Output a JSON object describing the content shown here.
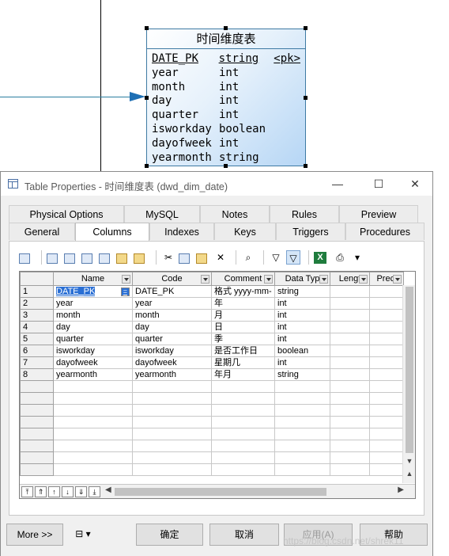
{
  "diagram": {
    "entity_name": "时间维度表",
    "attributes": [
      {
        "name": "DATE_PK",
        "type": "string",
        "key": "<pk>"
      },
      {
        "name": "year",
        "type": "int",
        "key": ""
      },
      {
        "name": "month",
        "type": "int",
        "key": ""
      },
      {
        "name": "day",
        "type": "int",
        "key": ""
      },
      {
        "name": "quarter",
        "type": "int",
        "key": ""
      },
      {
        "name": "isworkday",
        "type": "boolean",
        "key": ""
      },
      {
        "name": "dayofweek",
        "type": "int",
        "key": ""
      },
      {
        "name": "yearmonth",
        "type": "string",
        "key": ""
      }
    ]
  },
  "dialog": {
    "title": "Table Properties - 时间维度表 (dwd_dim_date)",
    "window_buttons": {
      "minimize": "—",
      "maximize": "☐",
      "close": "✕"
    },
    "tabs_row1": [
      "Physical Options",
      "MySQL",
      "Notes",
      "Rules",
      "Preview"
    ],
    "tabs_row2": [
      "General",
      "Columns",
      "Indexes",
      "Keys",
      "Triggers",
      "Procedures"
    ],
    "active_tab": "Columns",
    "columns_table": {
      "headers": [
        "Name",
        "Code",
        "Comment",
        "Data Typ",
        "Lengt",
        "Preci"
      ],
      "rows": [
        {
          "num": "1",
          "name": "DATE_PK",
          "code": "DATE_PK",
          "comment": "格式 yyyy-mm-",
          "type": "string"
        },
        {
          "num": "2",
          "name": "year",
          "code": "year",
          "comment": "年",
          "type": "int"
        },
        {
          "num": "3",
          "name": "month",
          "code": "month",
          "comment": "月",
          "type": "int"
        },
        {
          "num": "4",
          "name": "day",
          "code": "day",
          "comment": "日",
          "type": "int"
        },
        {
          "num": "5",
          "name": "quarter",
          "code": "quarter",
          "comment": "季",
          "type": "int"
        },
        {
          "num": "6",
          "name": "isworkday",
          "code": "isworkday",
          "comment": "是否工作日",
          "type": "boolean"
        },
        {
          "num": "7",
          "name": "dayofweek",
          "code": "dayofweek",
          "comment": "星期几",
          "type": "int"
        },
        {
          "num": "8",
          "name": "yearmonth",
          "code": "yearmonth",
          "comment": "年月",
          "type": "string"
        }
      ],
      "selected_cell_marker": "="
    },
    "buttons": {
      "more": "More >>",
      "ok": "确定",
      "cancel": "取消",
      "apply": "应用(A)",
      "help": "帮助"
    }
  },
  "watermark": "https://blog.csdn.net/shrek11"
}
